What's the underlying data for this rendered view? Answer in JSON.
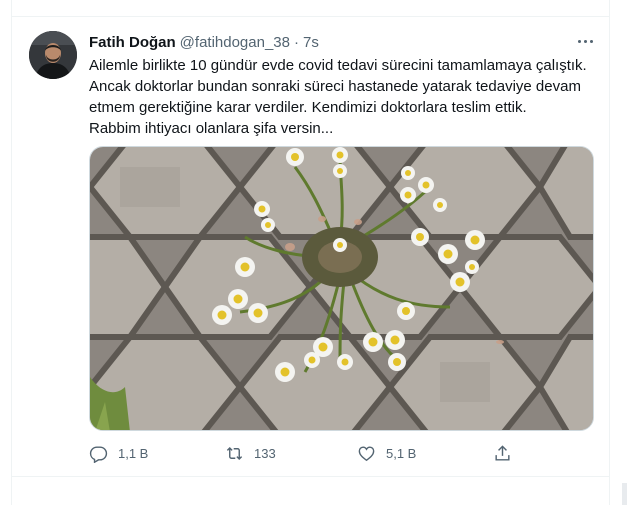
{
  "tweet": {
    "author_name": "Fatih Doğan",
    "handle": "@fatihdogan_38",
    "separator": "·",
    "time": "7s",
    "text_lines": [
      "Ailemle birlikte 10 gündür evde covid tedavi sürecini tamamlamaya çalıştık.",
      "Ancak doktorlar bundan sonraki süreci hastanede yatarak tedaviye devam",
      "etmem gerektiğine karar verdiler. Kendimizi doktorlara teslim ettik.",
      "Rabbim ihtiyacı olanlara şifa versin..."
    ]
  },
  "actions": {
    "reply_count": "1,1 B",
    "retweet_count": "133",
    "like_count": "5,1 B"
  },
  "icons": {
    "reply": "reply-icon",
    "retweet": "retweet-icon",
    "like": "heart-icon",
    "share": "share-icon",
    "more": "more-icon"
  },
  "colors": {
    "text_primary": "#0f1419",
    "text_secondary": "#536471",
    "border": "#eff3f4"
  }
}
